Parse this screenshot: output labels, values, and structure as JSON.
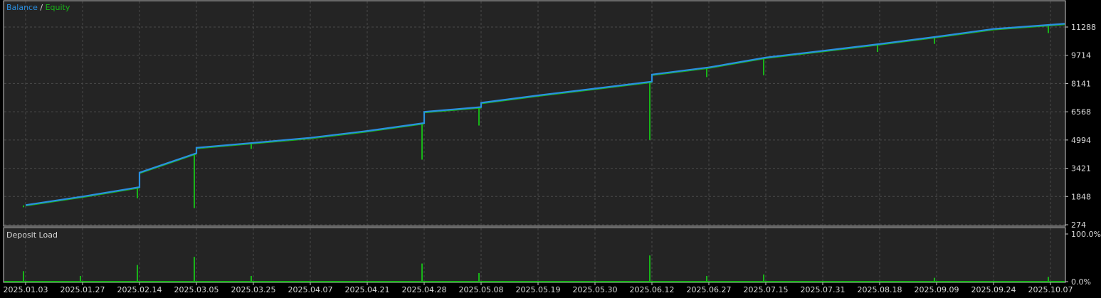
{
  "legend": {
    "balance": "Balance",
    "separator": " / ",
    "equity": "Equity"
  },
  "colors": {
    "balance": "#2a8fe0",
    "equity": "#18b418",
    "background": "#000000",
    "panel": "#242424",
    "grid": "#4a4a4a",
    "text": "#d8d8d8"
  },
  "chart_data": [
    {
      "type": "line",
      "series": [
        {
          "name": "Balance",
          "x": [
            "2025.01.03",
            "2025.01.27",
            "2025.02.14",
            "2025.02.14",
            "2025.03.05",
            "2025.03.05",
            "2025.03.25",
            "2025.04.07",
            "2025.04.21",
            "2025.04.28",
            "2025.04.28",
            "2025.05.08",
            "2025.05.08",
            "2025.05.19",
            "2025.05.30",
            "2025.06.12",
            "2025.06.12",
            "2025.06.27",
            "2025.07.15",
            "2025.07.31",
            "2025.08.18",
            "2025.09.09",
            "2025.09.24",
            "2025.10.07"
          ],
          "y": [
            1370,
            1848,
            2370,
            3180,
            4260,
            4560,
            4840,
            5120,
            5500,
            5940,
            6560,
            6830,
            7070,
            7480,
            7860,
            8250,
            8640,
            9040,
            9590,
            9960,
            10340,
            10750,
            11180,
            11470
          ]
        },
        {
          "name": "Equity",
          "dips": [
            {
              "x": "2025.01.03",
              "low": 1250
            },
            {
              "x": "2025.02.14",
              "low": 1750
            },
            {
              "x": "2025.03.05",
              "low": 1200
            },
            {
              "x": "2025.03.25",
              "low": 4500
            },
            {
              "x": "2025.04.28",
              "low": 3900
            },
            {
              "x": "2025.05.08",
              "low": 5800
            },
            {
              "x": "2025.06.12",
              "low": 5000
            },
            {
              "x": "2025.06.27",
              "low": 8500
            },
            {
              "x": "2025.07.15",
              "low": 8600
            },
            {
              "x": "2025.08.18",
              "low": 9900
            },
            {
              "x": "2025.09.09",
              "low": 10350
            },
            {
              "x": "2025.10.07",
              "low": 10950
            }
          ]
        }
      ],
      "yticks": [
        "11288",
        "9714",
        "8141",
        "6568",
        "4994",
        "3421",
        "1848",
        "274"
      ],
      "ylim": [
        274,
        11800
      ],
      "grid": true,
      "legend_position": "top-left"
    },
    {
      "type": "bar",
      "title": "Deposit Load",
      "x": [
        "2025.01.03",
        "2025.01.27",
        "2025.02.14",
        "2025.03.05",
        "2025.03.25",
        "2025.04.28",
        "2025.05.08",
        "2025.06.12",
        "2025.06.27",
        "2025.07.15",
        "2025.09.09",
        "2025.10.07"
      ],
      "values": [
        22,
        12,
        35,
        52,
        12,
        38,
        18,
        55,
        12,
        15,
        8,
        10
      ],
      "yticks": [
        "100.0%",
        "0.0%"
      ],
      "ylim": [
        0,
        100
      ],
      "grid": true
    }
  ],
  "xticks": [
    "2025.01.03",
    "2025.01.27",
    "2025.02.14",
    "2025.03.05",
    "2025.03.25",
    "2025.04.07",
    "2025.04.21",
    "2025.04.28",
    "2025.05.08",
    "2025.05.19",
    "2025.05.30",
    "2025.06.12",
    "2025.06.27",
    "2025.07.15",
    "2025.07.31",
    "2025.08.18",
    "2025.09.09",
    "2025.09.24",
    "2025.10.07"
  ]
}
